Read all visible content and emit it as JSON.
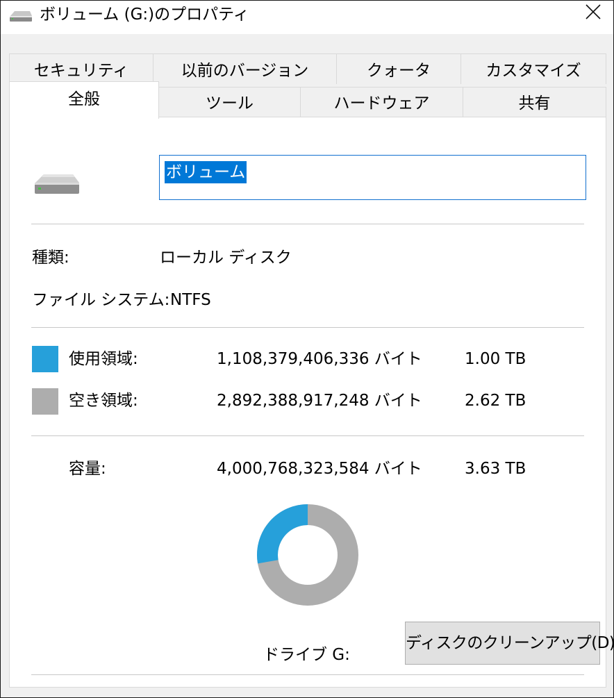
{
  "window": {
    "title": "ボリューム (G:)のプロパティ",
    "icon": "drive-icon",
    "close": "close-icon"
  },
  "tabs": {
    "row1": [
      "セキュリティ",
      "以前のバージョン",
      "クォータ",
      "カスタマイズ"
    ],
    "row2": [
      "全般",
      "ツール",
      "ハードウェア",
      "共有"
    ],
    "active": "全般"
  },
  "general": {
    "volume_name": "ボリューム",
    "type_label": "種類:",
    "type_value": "ローカル ディスク",
    "fs_label": "ファイル システム:",
    "fs_value": "NTFS",
    "used": {
      "label": "使用領域:",
      "bytes": "1,108,379,406,336 バイト",
      "size": "1.00 TB",
      "color": "#26a0da"
    },
    "free": {
      "label": "空き領域:",
      "bytes": "2,892,388,917,248 バイト",
      "size": "2.62 TB",
      "color": "#adadad"
    },
    "capacity": {
      "label": "容量:",
      "bytes": "4,000,768,323,584 バイト",
      "size": "3.63 TB"
    },
    "usage_fraction": 0.277,
    "drive_label": "ドライブ G:",
    "cleanup_button": "ディスクのクリーンアップ(D)"
  }
}
